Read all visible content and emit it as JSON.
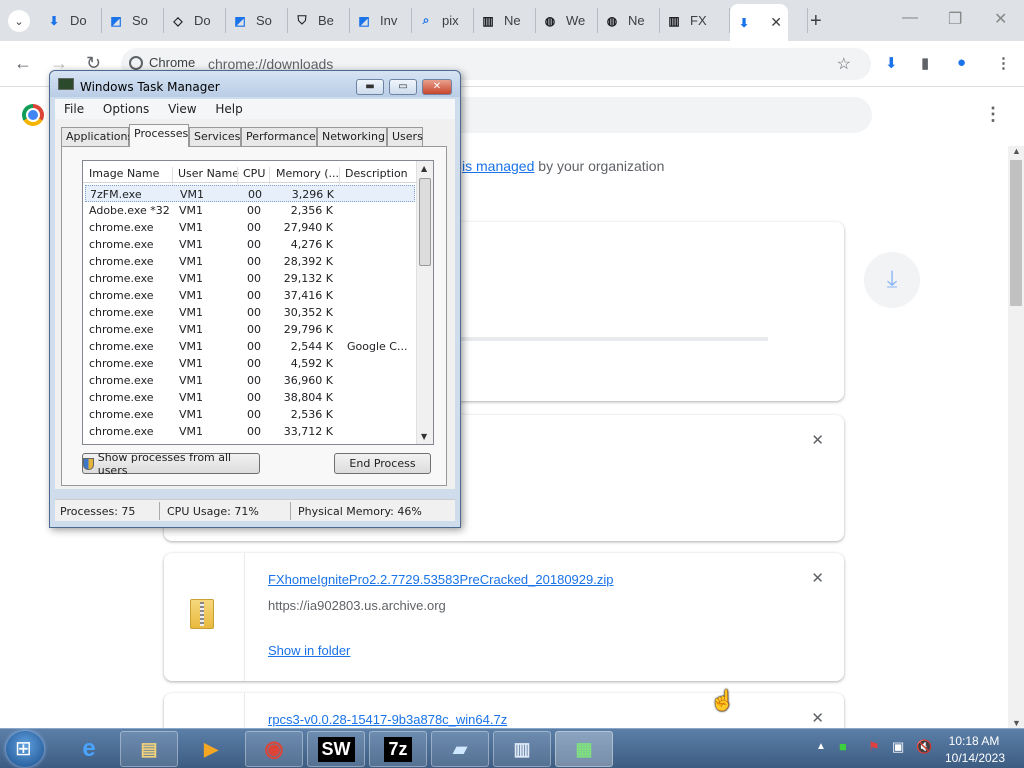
{
  "tabs": [
    {
      "label": "Do",
      "icon": "download-icon",
      "color": "#1a73e8"
    },
    {
      "label": "So",
      "icon": "sourceforge-icon",
      "color": "#1a73e8"
    },
    {
      "label": "Do",
      "icon": "diamond-icon",
      "color": "#202124"
    },
    {
      "label": "So",
      "icon": "sourceforge-icon",
      "color": "#1a73e8"
    },
    {
      "label": "Be",
      "icon": "shield-icon",
      "color": "#202124"
    },
    {
      "label": "Inv",
      "icon": "sourceforge-icon",
      "color": "#1a73e8"
    },
    {
      "label": "pix",
      "icon": "search-icon",
      "color": "#1a73e8"
    },
    {
      "label": "Ne",
      "icon": "archive-icon",
      "color": "#202124"
    },
    {
      "label": "We",
      "icon": "globe-icon",
      "color": "#202124"
    },
    {
      "label": "Ne",
      "icon": "globe-icon",
      "color": "#202124"
    },
    {
      "label": "FX",
      "icon": "archive-icon",
      "color": "#202124"
    },
    {
      "label": "",
      "icon": "download-icon",
      "color": "#1a73e8",
      "active": true
    },
    {
      "label": "(",
      "icon": "",
      "color": "#202124"
    }
  ],
  "omnibox": {
    "chip": "Chrome",
    "url": "chrome://downloads"
  },
  "page": {
    "managed_link": "is managed",
    "managed_suffix": "by your organization",
    "downloads": [
      {
        "filename": "FXhomeIgnitePro2.2.7729.53583PreCracked_20180929.zip",
        "source": "https://ia902803.us.archive.org",
        "action": "Show in folder"
      },
      {
        "filename": "rpcs3-v0.0.28-15417-9b3a878c_win64.7z"
      }
    ]
  },
  "task_manager": {
    "title": "Windows Task Manager",
    "menu": [
      "File",
      "Options",
      "View",
      "Help"
    ],
    "tabs": [
      "Applications",
      "Processes",
      "Services",
      "Performance",
      "Networking",
      "Users"
    ],
    "active_tab": "Processes",
    "columns": [
      "Image Name",
      "User Name",
      "CPU",
      "Memory (...",
      "Description"
    ],
    "rows": [
      [
        "7zFM.exe",
        "VM1",
        "00",
        "3,296 K",
        ""
      ],
      [
        "Adobe.exe *32",
        "VM1",
        "00",
        "2,356 K",
        ""
      ],
      [
        "chrome.exe",
        "VM1",
        "00",
        "27,940 K",
        ""
      ],
      [
        "chrome.exe",
        "VM1",
        "00",
        "4,276 K",
        ""
      ],
      [
        "chrome.exe",
        "VM1",
        "00",
        "28,392 K",
        ""
      ],
      [
        "chrome.exe",
        "VM1",
        "00",
        "29,132 K",
        ""
      ],
      [
        "chrome.exe",
        "VM1",
        "00",
        "37,416 K",
        ""
      ],
      [
        "chrome.exe",
        "VM1",
        "00",
        "30,352 K",
        ""
      ],
      [
        "chrome.exe",
        "VM1",
        "00",
        "29,796 K",
        ""
      ],
      [
        "chrome.exe",
        "VM1",
        "00",
        "2,544 K",
        "Google C..."
      ],
      [
        "chrome.exe",
        "VM1",
        "00",
        "4,592 K",
        ""
      ],
      [
        "chrome.exe",
        "VM1",
        "00",
        "36,960 K",
        ""
      ],
      [
        "chrome.exe",
        "VM1",
        "00",
        "38,804 K",
        ""
      ],
      [
        "chrome.exe",
        "VM1",
        "00",
        "2,536 K",
        ""
      ],
      [
        "chrome.exe",
        "VM1",
        "00",
        "33,712 K",
        ""
      ]
    ],
    "show_all_button": "Show processes from all users",
    "end_process_button": "End Process",
    "status": {
      "processes": "Processes: 75",
      "cpu": "CPU Usage: 71%",
      "memory": "Physical Memory: 46%"
    }
  },
  "taskbar": {
    "apps": [
      "start-button",
      "internet-explorer-icon",
      "file-explorer-icon",
      "media-player-icon",
      "chrome-icon",
      "sw-icon",
      "7zip-icon",
      "notepad-icon",
      "document-icon",
      "task-manager-icon"
    ],
    "time": "10:18 AM",
    "date": "10/14/2023"
  }
}
